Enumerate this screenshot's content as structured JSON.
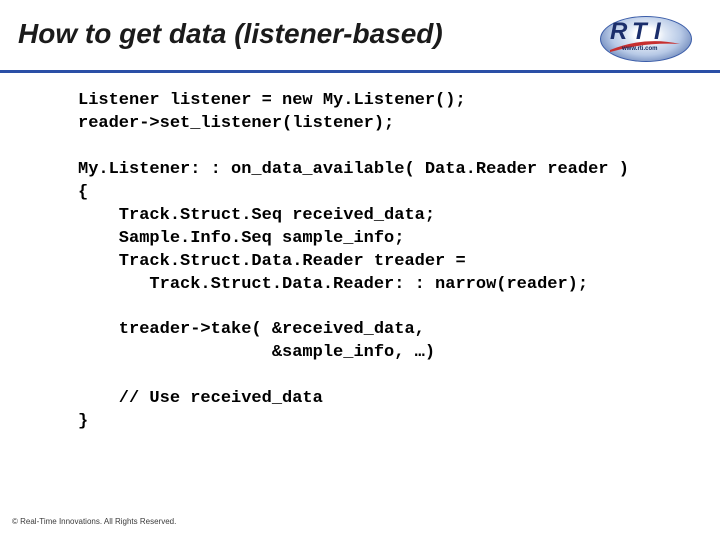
{
  "title": "How to get data (listener-based)",
  "logo": {
    "letters": [
      "R",
      "T",
      "I"
    ],
    "url": "www.rti.com"
  },
  "code": {
    "l1": "Listener listener = new My.Listener();",
    "l2": "reader->set_listener(listener);",
    "l3": "",
    "l4": "My.Listener: : on_data_available( Data.Reader reader )",
    "l5": "{",
    "l6": "    Track.Struct.Seq received_data;",
    "l7": "    Sample.Info.Seq sample_info;",
    "l8": "    Track.Struct.Data.Reader treader =",
    "l9": "       Track.Struct.Data.Reader: : narrow(reader);",
    "l10": "",
    "l11": "    treader->take( &received_data,",
    "l12": "                   &sample_info, …)",
    "l13": "",
    "l14": "    // Use received_data",
    "l15": "}"
  },
  "copyright": "© Real-Time Innovations. All Rights Reserved."
}
